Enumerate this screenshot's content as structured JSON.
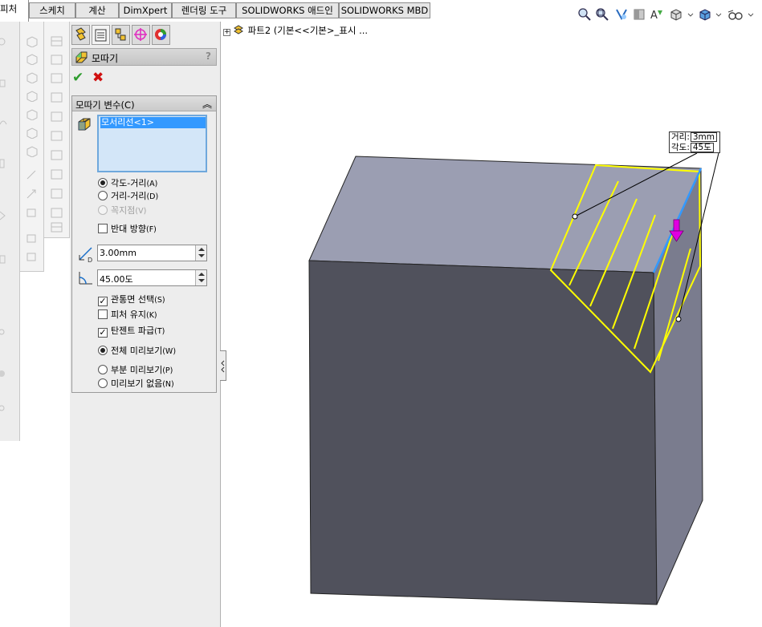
{
  "tabs": [
    {
      "label": "피처",
      "active": true
    },
    {
      "label": "스케치"
    },
    {
      "label": "계산"
    },
    {
      "label": "DimXpert"
    },
    {
      "label": "렌더링 도구"
    },
    {
      "label": "SOLIDWORKS 애드인"
    },
    {
      "label": "SOLIDWORKS MBD"
    }
  ],
  "view_tools": [
    "zoom-to-fit-icon",
    "zoom-area-icon",
    "previous-view-icon",
    "section-view-icon",
    "dynamic-annotation-icon",
    "display-style-icon",
    "view-orientation-icon",
    "hide-show-items-icon"
  ],
  "property_manager": {
    "tabs": [
      "feature-manager-tab",
      "property-manager-tab",
      "configuration-manager-tab",
      "dimxpert-manager-tab",
      "display-manager-tab"
    ],
    "title": "모따기",
    "help": "?",
    "group": {
      "title": "모따기 변수(C)",
      "edge_selection": "모서리선<1>",
      "type_options": [
        {
          "label": "각도-거리",
          "key": "(A)",
          "selected": true,
          "enabled": true
        },
        {
          "label": "거리-거리",
          "key": "(D)",
          "selected": false,
          "enabled": true
        },
        {
          "label": "꼭지점",
          "key": "(V)",
          "selected": false,
          "enabled": false
        }
      ],
      "flip_direction": {
        "label": "반대 방향",
        "key": "(F)",
        "checked": false
      },
      "distance_value": "3.00mm",
      "angle_value": "45.00도",
      "checkboxes": [
        {
          "label": "관통면 선택",
          "key": "(S)",
          "checked": true
        },
        {
          "label": "피처 유지",
          "key": "(K)",
          "checked": false
        },
        {
          "label": "탄젠트 파급",
          "key": "(T)",
          "checked": true
        }
      ],
      "preview_options": [
        {
          "label": "전체 미리보기",
          "key": "(W)",
          "selected": true
        },
        {
          "label": "부분 미리보기",
          "key": "(P)",
          "selected": false
        },
        {
          "label": "미리보기 없음",
          "key": "(N)",
          "selected": false
        }
      ]
    }
  },
  "tree": {
    "expand": "+",
    "label": "파트2  (기본<<기본>_표시 ..."
  },
  "callout": {
    "distance_label": "거리:",
    "distance": "3mm",
    "angle_label": "각도:",
    "angle": "45도"
  },
  "colors": {
    "box_top": "#9b9eb2",
    "box_front": "#50515c",
    "box_right": "#7a7c8e",
    "preview": "#ffff00",
    "edge": "#3399ff",
    "arrow": "#e000e0"
  }
}
